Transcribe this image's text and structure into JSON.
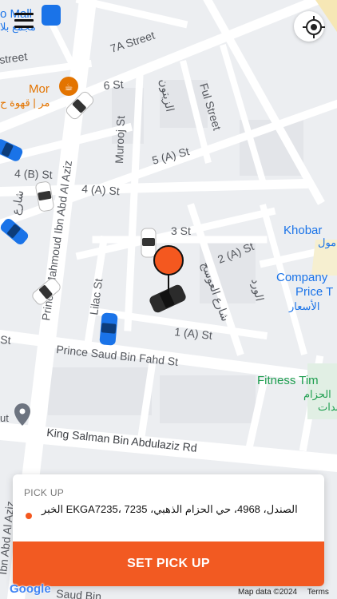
{
  "map": {
    "streets": {
      "s7a": "7A Street",
      "s6": "6 St",
      "murooj": "Murooj St",
      "ful": "Ful Street",
      "arabic_tr": "الزيتون",
      "s5a": "5 (A) St",
      "s4b": "4 (B) St",
      "s4a": "4 (A) St",
      "s3": "3 St",
      "s2a": "2 (A) St",
      "lilac": "Lilac St",
      "s1a": "1 (A) St",
      "prince_saud": "Prince Saud Bin Fahd St",
      "prince_mahmoud": "Prince Mahmoud Ibn Abd Al Aziz",
      "king_salman": "King Salman Bin Abdulaziz Rd",
      "ibn_abd_al_aziz": "Ibn Abd Al Aziz",
      "saud_bin": "Saud Bin",
      "street_left": "street",
      "arabic_awsa": "شارع العوسج",
      "arabic_ward": "الورد",
      "arabic_left": "شارع",
      "st_edge": "St"
    },
    "pois": {
      "mall": "o Mall",
      "mall_ar": "مجمع بلا",
      "mor": "Mor",
      "mor_ar": "مر | قهوة ح",
      "khobar_title": "Khobar",
      "khobar_ar": "مول",
      "company_title": "Company",
      "company_sub": "Price T",
      "company_ar": "الأسعار",
      "fitness": "Fitness Tim",
      "fitness_ar1": "الحزام",
      "fitness_ar2": "بدات",
      "ut": "ut"
    },
    "colors": {
      "pin": "#f4581f",
      "water_blue": "#1a73e8",
      "poi_teal": "#1e9e4f",
      "poi_orange": "#e37400"
    }
  },
  "controls": {
    "menu_icon": "hamburger-menu-icon",
    "locate_icon": "crosshair-locate-icon"
  },
  "pickup": {
    "label": "PICK UP",
    "address": "الصندل، 4968، حي الحزام الذهبي، 7235 ،EKGA7235 الخبر"
  },
  "action": {
    "button": "SET PICK UP"
  },
  "footer": {
    "logo": "Google",
    "map_data": "Map data ©2024",
    "terms": "Terms"
  }
}
